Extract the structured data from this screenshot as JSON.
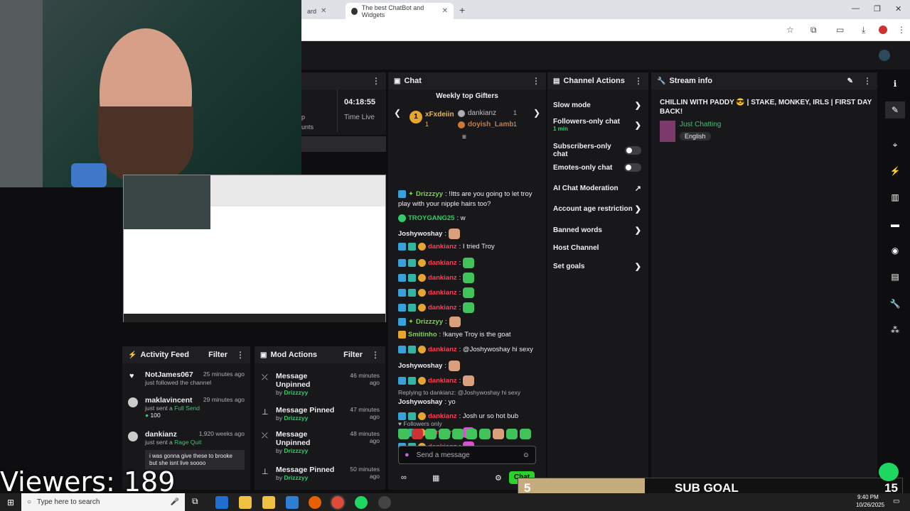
{
  "browser": {
    "tab1_label": "ard",
    "tab2_label": "The best ChatBot and Widgets",
    "new_tab": "+",
    "win_min": "—",
    "win_max": "❐",
    "win_close": "✕"
  },
  "dashboard": {
    "time_live": "04:18:55",
    "time_live_label": "Time Live",
    "partial_labels": [
      "p",
      "unts"
    ]
  },
  "chat": {
    "title": "Chat",
    "weekly_title": "Weekly top Gifters",
    "gifters": [
      {
        "name": "xFxdeiin",
        "rank": "1",
        "count": "1"
      },
      {
        "name": "dankianz",
        "count": "1"
      },
      {
        "name": "doyish_Lamb",
        "count": "1"
      }
    ],
    "lines": [
      {
        "nick": "Drizzzyy",
        "color": "#7bd44a",
        "text": ": !Itts are you going to let troy"
      },
      {
        "nick": "",
        "color": "#efeff1",
        "text": "play with your nipple hairs too?"
      },
      {
        "nick": "TROYGANG25",
        "color": "#36c96d",
        "text": ": w"
      },
      {
        "nick": "Joshywoshay",
        "color": "#efeff1",
        "text": ":"
      },
      {
        "nick": "dankianz",
        "color": "#ff3d5a",
        "text": ": I tried Troy"
      },
      {
        "nick": "dankianz",
        "color": "#ff3d5a",
        "text": ":"
      },
      {
        "nick": "dankianz",
        "color": "#ff3d5a",
        "text": ":"
      },
      {
        "nick": "dankianz",
        "color": "#ff3d5a",
        "text": ":"
      },
      {
        "nick": "dankianz",
        "color": "#ff3d5a",
        "text": ":"
      },
      {
        "nick": "Drizzzyy",
        "color": "#7bd44a",
        "text": ":"
      },
      {
        "nick": "Smitinho",
        "color": "#7bd44a",
        "text": ": !kanye Troy is the goat"
      },
      {
        "nick": "dankianz",
        "color": "#ff3d5a",
        "text": ": @Joshywoshay hi sexy"
      },
      {
        "nick": "Joshywoshay",
        "color": "#efeff1",
        "text": ":"
      },
      {
        "nick": "dankianz",
        "color": "#ff3d5a",
        "text": ":"
      },
      {
        "nick": "",
        "color": "#adadb8",
        "text": "Replying to dankianz: @Joshywoshay hi sexy"
      },
      {
        "nick": "Joshywoshay",
        "color": "#efeff1",
        "text": ": yo"
      },
      {
        "nick": "dankianz",
        "color": "#ff3d5a",
        "text": ": Josh ur so hot bub"
      },
      {
        "nick": "dankianz",
        "color": "#ff3d5a",
        "text": ":"
      },
      {
        "nick": "dankianz",
        "color": "#ff3d5a",
        "text": ":"
      }
    ],
    "followers_only": "Followers only",
    "placeholder": "Send a message",
    "chat_button": "Chat"
  },
  "channel_actions": {
    "title": "Channel Actions",
    "items": [
      {
        "label": "Slow mode",
        "kind": "chev"
      },
      {
        "label": "Followers-only chat",
        "sub": "1 min",
        "kind": "chev"
      },
      {
        "label": "Subscribers-only chat",
        "kind": "toggle"
      },
      {
        "label": "Emotes-only chat",
        "kind": "toggle"
      },
      {
        "label": "AI Chat Moderation",
        "kind": "ext"
      },
      {
        "label": "Account age restriction",
        "kind": "chev"
      },
      {
        "label": "Banned words",
        "kind": "chev"
      },
      {
        "label": "Host Channel",
        "kind": "none"
      },
      {
        "label": "Set goals",
        "kind": "chev"
      }
    ]
  },
  "stream_info": {
    "title": "Stream info",
    "stream_title": "CHILLIN WITH PADDY 😎 | STAKE, MONKEY, IRLS | FIRST DAY BACK!",
    "category": "Just Chatting",
    "language": "English"
  },
  "activity": {
    "title": "Activity Feed",
    "filter": "Filter",
    "items": [
      {
        "name": "NotJames067",
        "desc": "just followed the channel",
        "time": "25 minutes ago"
      },
      {
        "name": "maklavincent",
        "desc": "just sent a",
        "highlight": "Full Send",
        "amount": "100",
        "time": "29 minutes ago"
      },
      {
        "name": "dankianz",
        "desc": "just sent a",
        "highlight": "Rage Quit",
        "time": "1,920 weeks ago",
        "message": "i was gonna give these to brooke but she isnt live soooo"
      }
    ]
  },
  "mod_actions": {
    "title": "Mod Actions",
    "filter": "Filter",
    "items": [
      {
        "action": "Message Unpinned",
        "by": "by",
        "user": "Drizzzyy",
        "time": "46 minutes ago"
      },
      {
        "action": "Message Pinned",
        "by": "by",
        "user": "Drizzzyy",
        "time": "47 minutes ago"
      },
      {
        "action": "Message Unpinned",
        "by": "by",
        "user": "Drizzzyy",
        "time": "48 minutes ago"
      },
      {
        "action": "Message Pinned",
        "by": "by",
        "user": "Drizzzyy",
        "time": "50 minutes ago"
      }
    ]
  },
  "overlay": {
    "viewers": "Viewers: 189",
    "sub_current": "5",
    "sub_label": "SUB GOAL",
    "sub_target": "15",
    "sub_progress": 0.33
  },
  "taskbar": {
    "search_placeholder": "Type here to search",
    "time": "9:40 PM",
    "date": "10/26/2025"
  }
}
